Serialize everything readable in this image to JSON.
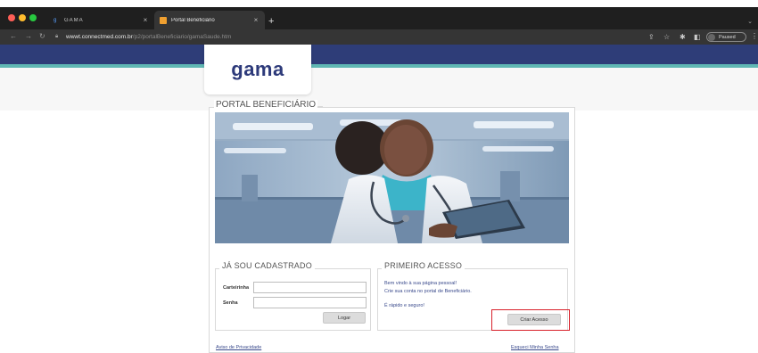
{
  "browser": {
    "tabs": [
      {
        "label": "GAMA",
        "close": "×"
      },
      {
        "label": "Portal Beneficiário",
        "close": "×"
      }
    ],
    "new_tab": "+",
    "address": {
      "host": "wwwt.connectmed.com.br",
      "path": "/p2/portalBeneficiario/gamaSaude.htm"
    },
    "profile_label": "Paused",
    "traffic_colors": [
      "#ff5f57",
      "#febc2e",
      "#28c840"
    ]
  },
  "brand": {
    "logo_text": "gama",
    "colors": {
      "navy": "#2e3d78",
      "teal": "#5fb7b3",
      "accent_link": "#3a4a8c",
      "highlight": "#d8202a"
    }
  },
  "portal": {
    "title": "PORTAL BENEFICIÁRIO"
  },
  "login": {
    "legend": "JÁ SOU CADASTRADO",
    "carteirinha_label": "Carteirinha",
    "carteirinha_value": "",
    "senha_label": "Senha",
    "senha_value": "",
    "submit_label": "Logar"
  },
  "first_access": {
    "legend": "PRIMEIRO ACESSO",
    "welcome_line1": "Bem vindo à sua página pessoal!",
    "welcome_line2": "Crie sua conta no portal de Beneficiário.",
    "tagline": "É rápido e seguro!",
    "create_label": "Criar Acesso"
  },
  "footer": {
    "privacy_link": "Aviso de Privacidade",
    "forgot_link": "Esqueci Minha Senha"
  }
}
